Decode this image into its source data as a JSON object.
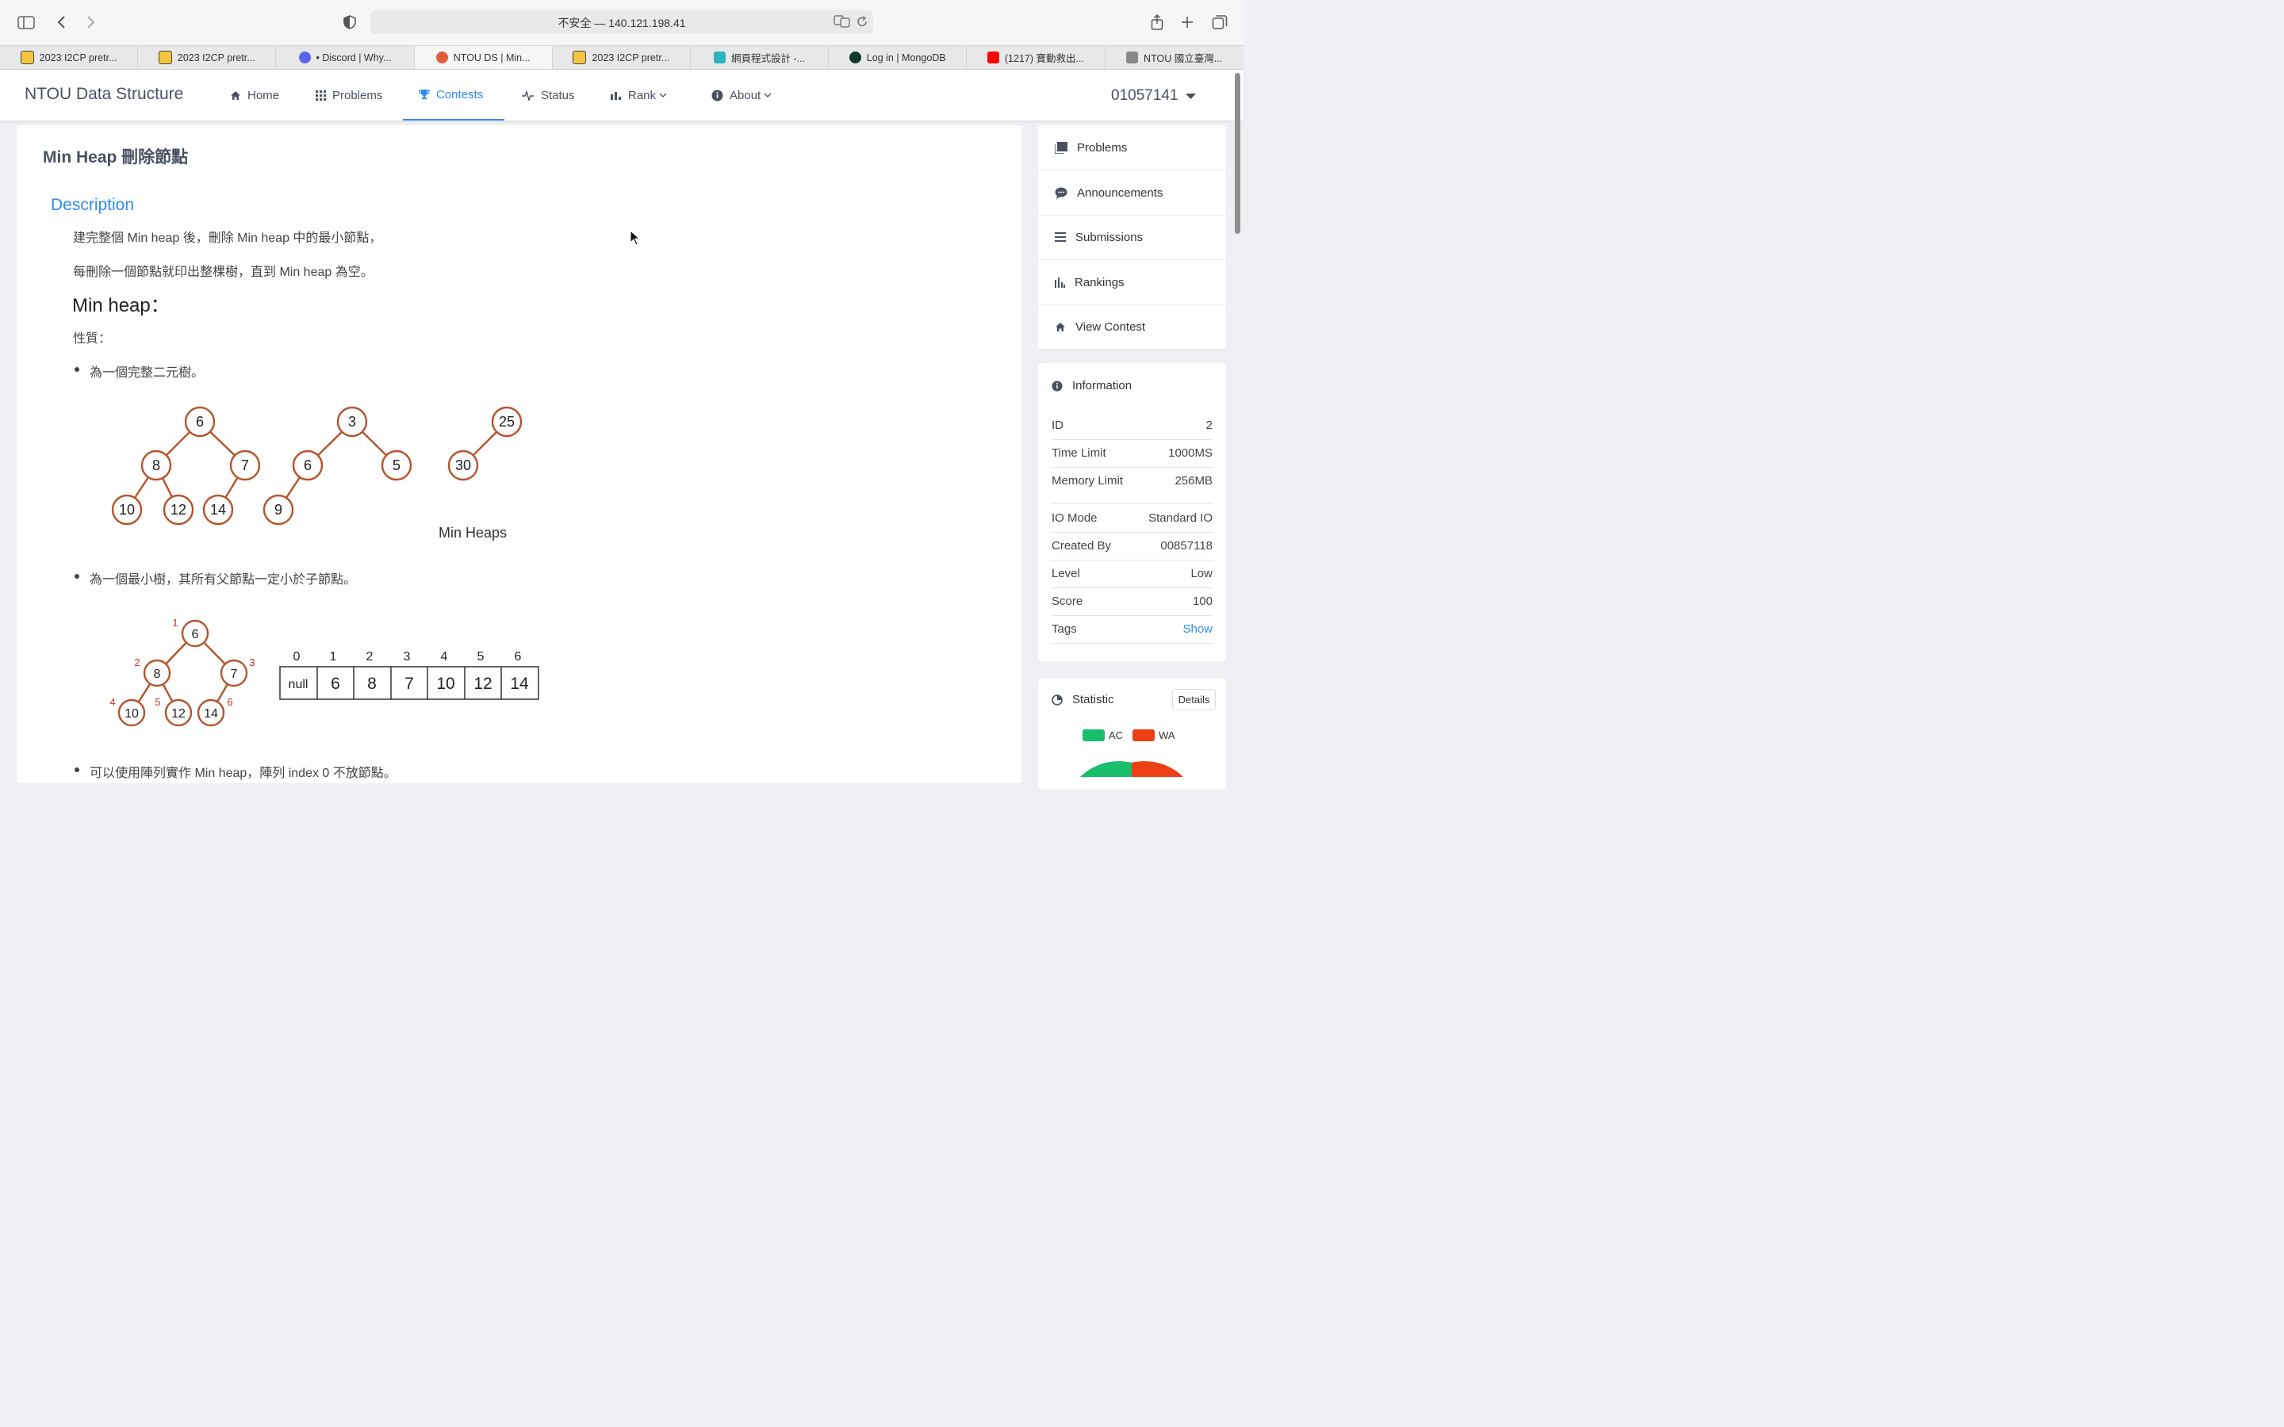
{
  "browser": {
    "url": "不安全 — 140.121.198.41",
    "tabs": [
      {
        "label": "2023 I2CP pretr...",
        "icon": "smiley-favicon"
      },
      {
        "label": "2023 I2CP pretr...",
        "icon": "smiley-favicon"
      },
      {
        "label": "• Discord | Why...",
        "icon": "discord-favicon"
      },
      {
        "label": "NTOU DS | Min...",
        "icon": "ntou-favicon",
        "active": true
      },
      {
        "label": "2023 I2CP pretr...",
        "icon": "smiley-favicon"
      },
      {
        "label": "網頁程式設計 -...",
        "icon": "pen-favicon"
      },
      {
        "label": "Log in | MongoDB",
        "icon": "mongodb-favicon"
      },
      {
        "label": "(1217) 寶動救出...",
        "icon": "youtube-favicon"
      },
      {
        "label": "NTOU 國立臺灣...",
        "icon": "notion-favicon"
      }
    ]
  },
  "navbar": {
    "brand": "NTOU Data Structure",
    "items": {
      "home": "Home",
      "problems": "Problems",
      "contests": "Contests",
      "status": "Status",
      "rank": "Rank",
      "about": "About"
    },
    "user": "01057141"
  },
  "problem": {
    "title": "Min Heap 刪除節點",
    "description_heading": "Description",
    "lines": [
      "建完整個 Min heap 後，刪除 Min heap 中的最小節點，",
      "每刪除一個節點就印出整棵樹，直到 Min heap 為空。"
    ],
    "subheading": "Min heap：",
    "property_label": "性質：",
    "bullets": [
      "為一個完整二元樹。",
      "為一個最小樹，其所有父節點一定小於子節點。",
      "可以使用陣列實作 Min heap，陣列 index 0 不放節點。"
    ],
    "figure1": {
      "caption": "Min Heaps",
      "tree1": [
        "6",
        "8",
        "7",
        "10",
        "12",
        "14"
      ],
      "tree2": [
        "3",
        "6",
        "5",
        "9"
      ],
      "tree3": [
        "25",
        "30"
      ]
    },
    "figure2": {
      "tree": [
        "6",
        "8",
        "7",
        "10",
        "12",
        "14"
      ],
      "index_labels": [
        "1",
        "2",
        "3",
        "4",
        "5",
        "6"
      ],
      "array_index": [
        "0",
        "1",
        "2",
        "3",
        "4",
        "5",
        "6"
      ],
      "array_values": [
        "null",
        "6",
        "8",
        "7",
        "10",
        "12",
        "14"
      ]
    }
  },
  "sidebar": {
    "menu": {
      "problems": "Problems",
      "announcements": "Announcements",
      "submissions": "Submissions",
      "rankings": "Rankings",
      "view_contest": "View Contest"
    },
    "information": {
      "heading": "Information",
      "rows": [
        {
          "k": "ID",
          "v": "2"
        },
        {
          "k": "Time Limit",
          "v": "1000MS"
        },
        {
          "k": "Memory Limit",
          "v": "256MB"
        },
        {
          "k": "IO Mode",
          "v": "Standard IO"
        },
        {
          "k": "Created By",
          "v": "00857118"
        },
        {
          "k": "Level",
          "v": "Low"
        },
        {
          "k": "Score",
          "v": "100"
        },
        {
          "k": "Tags",
          "v": "Show"
        }
      ]
    },
    "statistic": {
      "heading": "Statistic",
      "details": "Details",
      "legend_ac": "AC",
      "legend_wa": "WA",
      "ac_color": "#19be6b",
      "wa_color": "#ed3f14"
    }
  },
  "colors": {
    "accent": "#2d8cf0",
    "tree": "#b5542b",
    "index_red": "#c0392b"
  }
}
